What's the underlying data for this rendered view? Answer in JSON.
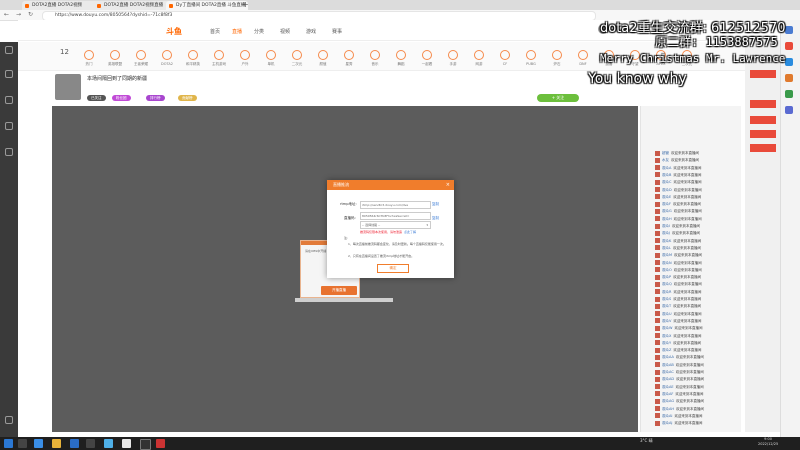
{
  "browser": {
    "tabs": [
      {
        "label": "DOTA2直播 DOTA2视频"
      },
      {
        "label": "DOTA2直播 DOTA2视频直播"
      },
      {
        "label": "Dy丁直播间 DOTA2直播 斗鱼直播"
      }
    ],
    "url": "https://www.douyu.com/8050564?dyshid=-71c8f8f3"
  },
  "site": {
    "logo": "斗鱼",
    "nav": [
      "首页",
      "直播",
      "分类",
      "视频",
      "游戏",
      "赛事"
    ],
    "active_nav": "直播",
    "categories": [
      "热门",
      "英雄联盟",
      "王者荣耀",
      "DOTA2",
      "和平精英",
      "主机游戏",
      "户外",
      "单机",
      "二次元",
      "颜值",
      "星秀",
      "音乐",
      "舞蹈",
      "一起看",
      "手游",
      "网游",
      "CF",
      "PUBG",
      "炉石",
      "DNF",
      "魔兽",
      "守望",
      "APEX",
      "二次元"
    ]
  },
  "room": {
    "title": "本场间隔回到了同期的新疆",
    "badges": [
      "已关注",
      "粉丝团",
      "排行榜",
      "贡献榜"
    ],
    "follow_label": "+ 关注"
  },
  "modal": {
    "title": "直播推流",
    "rtmp_label": "rtmp地址:",
    "rtmp_value": "rtmp://sendtc3.douyu.com/live",
    "rtmp_copy": "复制",
    "code_label": "直播码:",
    "code_value": "8050564r6CTb8Fhv?wsSecret=",
    "code_copy": "复制",
    "select_value": "-- 选择线路 --",
    "warning": "推流码仅限本次使用，请勿泄露",
    "warning_link": "点此了解",
    "notes_title": "注:",
    "notes": [
      "1、每次直播前推流码都会变化，请及时更新。每个直播码仅能使用一次。",
      "2、只有在直播间设置了推流rtmp地址才能开启。"
    ],
    "confirm_label": "确定"
  },
  "background_dialog": {
    "button_label": "开播直播",
    "text": "请在OBS中开播"
  },
  "chat": [
    {
      "user": "超管",
      "msg": "欢迎来到本直播间"
    },
    {
      "user": "水友",
      "msg": "欢迎来到本直播间"
    },
    {
      "user": "观众A",
      "msg": "欢迎来到本直播间"
    },
    {
      "user": "观众B",
      "msg": "欢迎来到本直播间"
    },
    {
      "user": "观众C",
      "msg": "欢迎来到本直播间"
    },
    {
      "user": "观众D",
      "msg": "欢迎来到本直播间"
    },
    {
      "user": "观众E",
      "msg": "欢迎来到本直播间"
    },
    {
      "user": "观众F",
      "msg": "欢迎来到本直播间"
    },
    {
      "user": "观众G",
      "msg": "欢迎来到本直播间"
    },
    {
      "user": "观众H",
      "msg": "欢迎来到本直播间"
    },
    {
      "user": "观众I",
      "msg": "欢迎来到本直播间"
    },
    {
      "user": "观众J",
      "msg": "欢迎来到本直播间"
    },
    {
      "user": "观众K",
      "msg": "欢迎来到本直播间"
    },
    {
      "user": "观众L",
      "msg": "欢迎来到本直播间"
    },
    {
      "user": "观众M",
      "msg": "欢迎来到本直播间"
    },
    {
      "user": "观众N",
      "msg": "欢迎来到本直播间"
    },
    {
      "user": "观众O",
      "msg": "欢迎来到本直播间"
    },
    {
      "user": "观众P",
      "msg": "欢迎来到本直播间"
    },
    {
      "user": "观众Q",
      "msg": "欢迎来到本直播间"
    },
    {
      "user": "观众R",
      "msg": "欢迎来到本直播间"
    },
    {
      "user": "观众S",
      "msg": "欢迎来到本直播间"
    },
    {
      "user": "观众T",
      "msg": "欢迎来到本直播间"
    },
    {
      "user": "观众U",
      "msg": "欢迎来到本直播间"
    },
    {
      "user": "观众V",
      "msg": "欢迎来到本直播间"
    },
    {
      "user": "观众W",
      "msg": "欢迎来到本直播间"
    },
    {
      "user": "观众X",
      "msg": "欢迎来到本直播间"
    },
    {
      "user": "观众Y",
      "msg": "欢迎来到本直播间"
    },
    {
      "user": "观众Z",
      "msg": "欢迎来到本直播间"
    },
    {
      "user": "观众AA",
      "msg": "欢迎来到本直播间"
    },
    {
      "user": "观众AB",
      "msg": "欢迎来到本直播间"
    },
    {
      "user": "观众AC",
      "msg": "欢迎来到本直播间"
    },
    {
      "user": "观众AD",
      "msg": "欢迎来到本直播间"
    },
    {
      "user": "观众AE",
      "msg": "欢迎来到本直播间"
    },
    {
      "user": "观众AF",
      "msg": "欢迎来到本直播间"
    },
    {
      "user": "观众AG",
      "msg": "欢迎来到本直播间"
    },
    {
      "user": "观众AH",
      "msg": "欢迎来到本直播间"
    },
    {
      "user": "观众AI",
      "msg": "欢迎来到本直播间"
    },
    {
      "user": "观众AJ",
      "msg": "欢迎来到本直播间"
    }
  ],
  "overlay": {
    "line1": "dota2重生交流群: 612512570",
    "line2": "原二群: 1153887575",
    "line3": "Merry Christmas Mr. Lawrence",
    "line4": "You know why"
  },
  "taskbar": {
    "weather": "3°C 晴",
    "time": "9:00",
    "date": "2022/12/25"
  },
  "colors": {
    "brand": "#f07d2c",
    "player_bg": "#5c5c5c",
    "link": "#3a7bd5",
    "warning": "#e23"
  }
}
